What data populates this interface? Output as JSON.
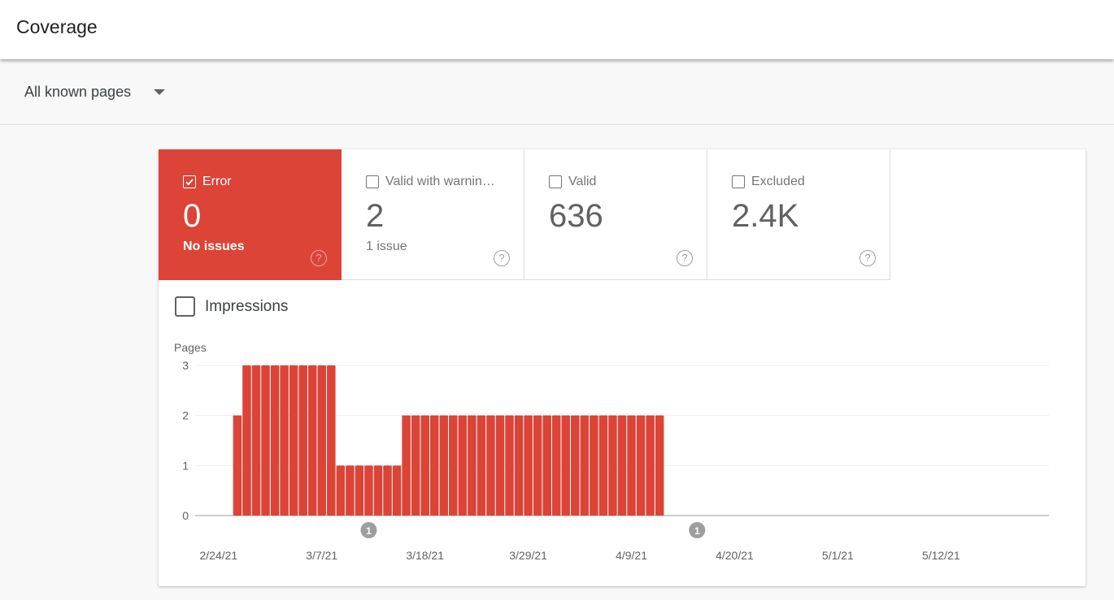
{
  "header": {
    "title": "Coverage"
  },
  "filter": {
    "selected": "All known pages"
  },
  "tiles": [
    {
      "label": "Error",
      "value": "0",
      "sub": "No issues",
      "checked": true,
      "active_color": "#db4437"
    },
    {
      "label": "Valid with warnin…",
      "value": "2",
      "sub": "1 issue",
      "checked": false
    },
    {
      "label": "Valid",
      "value": "636",
      "sub": "",
      "checked": false
    },
    {
      "label": "Excluded",
      "value": "2.4K",
      "sub": "",
      "checked": false
    }
  ],
  "impressions": {
    "label": "Impressions",
    "checked": false
  },
  "chart_data": {
    "type": "bar",
    "title": "",
    "ylabel": "Pages",
    "xlabel": "",
    "ylim": [
      0,
      3
    ],
    "y_ticks": [
      "0",
      "1",
      "2",
      "3"
    ],
    "x_range_days": 91,
    "x_tick_labels": [
      "2/24/21",
      "3/7/21",
      "3/18/21",
      "3/29/21",
      "4/9/21",
      "4/20/21",
      "5/1/21",
      "5/12/21"
    ],
    "x_tick_day_index": [
      2,
      13,
      24,
      35,
      46,
      57,
      68,
      79
    ],
    "first_bar_day_index": 4,
    "bar_color": "#db4437",
    "series": [
      {
        "name": "Error",
        "values": [
          2,
          3,
          3,
          3,
          3,
          3,
          3,
          3,
          3,
          3,
          3,
          1,
          1,
          1,
          1,
          1,
          1,
          1,
          2,
          2,
          2,
          2,
          2,
          2,
          2,
          2,
          2,
          2,
          2,
          2,
          2,
          2,
          2,
          2,
          2,
          2,
          2,
          2,
          2,
          2,
          2,
          2,
          2,
          2,
          2,
          2
        ]
      }
    ],
    "annotations": [
      {
        "label": "1",
        "day_index": 18.5
      },
      {
        "label": "1",
        "day_index": 53.5
      }
    ],
    "grid": true,
    "legend": "none"
  }
}
